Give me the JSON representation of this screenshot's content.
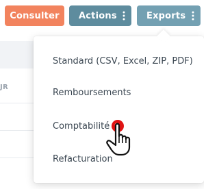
{
  "toolbar": {
    "consulter_label": "Consulter",
    "actions_label": "Actions",
    "exports_label": "Exports",
    "more_icon": "kebab-vertical-icon"
  },
  "background": {
    "column_header_fragment": "JR"
  },
  "export_menu": {
    "items": [
      {
        "label": "Standard (CSV, Excel, ZIP, PDF)"
      },
      {
        "label": "Remboursements"
      },
      {
        "label": "Comptabilité"
      },
      {
        "label": "Refacturation"
      }
    ],
    "hovered_item": "Comptabilité"
  },
  "pointer": {
    "icon": "hand-pointer-icon",
    "click_marker_color": "#e01414"
  },
  "colors": {
    "consulter_bg": "#f2835e",
    "actions_bg": "#5e8c9e",
    "exports_bg": "#73a0b2",
    "menu_text": "#3a4651"
  }
}
